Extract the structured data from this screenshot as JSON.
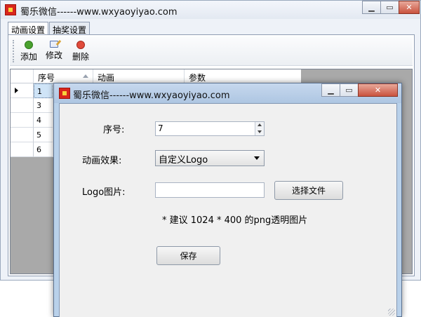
{
  "main_window": {
    "title": "蜀乐微信------www.wxyaoyiyao.com",
    "tabs": [
      {
        "label": "动画设置"
      },
      {
        "label": "抽奖设置"
      }
    ],
    "toolbar": {
      "add_label": "添加",
      "edit_label": "修改",
      "delete_label": "删除",
      "icons": {
        "add": "add-icon",
        "edit": "edit-icon",
        "delete": "delete-icon"
      }
    },
    "grid": {
      "columns": [
        "序号",
        "动画",
        "参数"
      ],
      "rows": [
        {
          "num": "1"
        },
        {
          "num": "3"
        },
        {
          "num": "4"
        },
        {
          "num": "5"
        },
        {
          "num": "6"
        }
      ]
    }
  },
  "dialog": {
    "title": "蜀乐微信------www.wxyaoyiyao.com",
    "seq_label": "序号:",
    "seq_value": "7",
    "effect_label": "动画效果:",
    "effect_value": "自定义Logo",
    "logo_label": "Logo图片:",
    "logo_value": "",
    "choose_file_label": "选择文件",
    "hint": "* 建议 1024 * 400 的png透明图片",
    "save_label": "保存"
  },
  "colors": {
    "titlebar": "#c6d8ee",
    "grid_empty": "#a9a9a9",
    "selected_cell": "#cfe4f7",
    "close_button": "#c9523e"
  }
}
